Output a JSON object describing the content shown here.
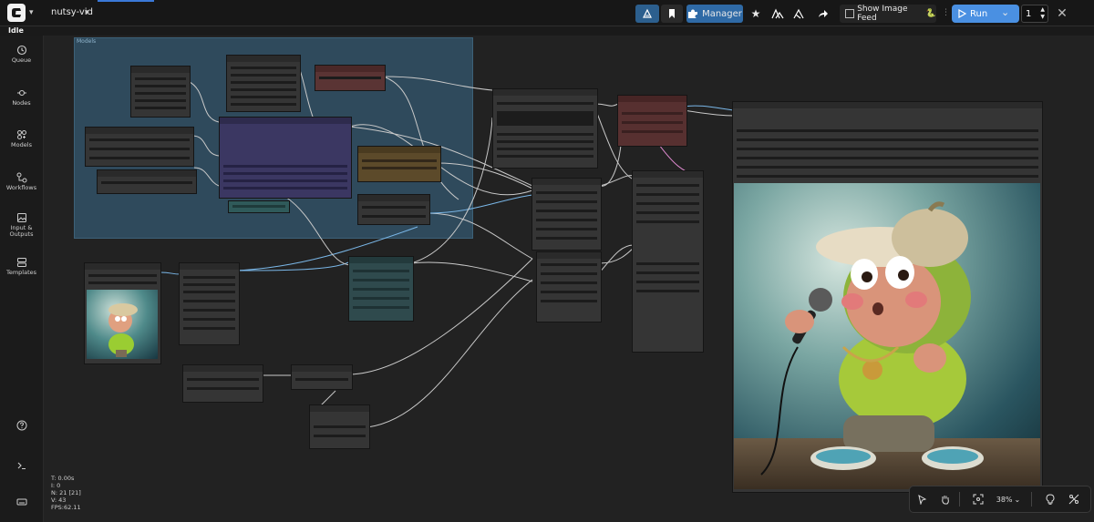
{
  "workflow": {
    "name": "nutsy-vid"
  },
  "toolbar": {
    "manager_label": "Manager",
    "show_image_feed_label": "Show Image Feed",
    "run_label": "Run",
    "queue_count": "1"
  },
  "status": {
    "text": "Idle"
  },
  "sidebar": {
    "items": [
      {
        "label": "Queue",
        "icon": "history-icon"
      },
      {
        "label": "Nodes",
        "icon": "nodes-icon"
      },
      {
        "label": "Models",
        "icon": "models-icon"
      },
      {
        "label": "Workflows",
        "icon": "workflows-icon"
      },
      {
        "label": "Input & Outputs",
        "icon": "image-icon"
      },
      {
        "label": "Templates",
        "icon": "templates-icon"
      }
    ]
  },
  "canvas": {
    "group_title": "Models",
    "stats": {
      "t": "T: 0.00s",
      "i": "I: 0",
      "n": "N: 21 [21]",
      "v": "V: 43",
      "fps": "FPS:62.11"
    }
  },
  "bottom_bar": {
    "zoom": "38%"
  },
  "colors": {
    "accent": "#3b7fd9",
    "run": "#4a90e2",
    "group": "#2f4a5c"
  }
}
